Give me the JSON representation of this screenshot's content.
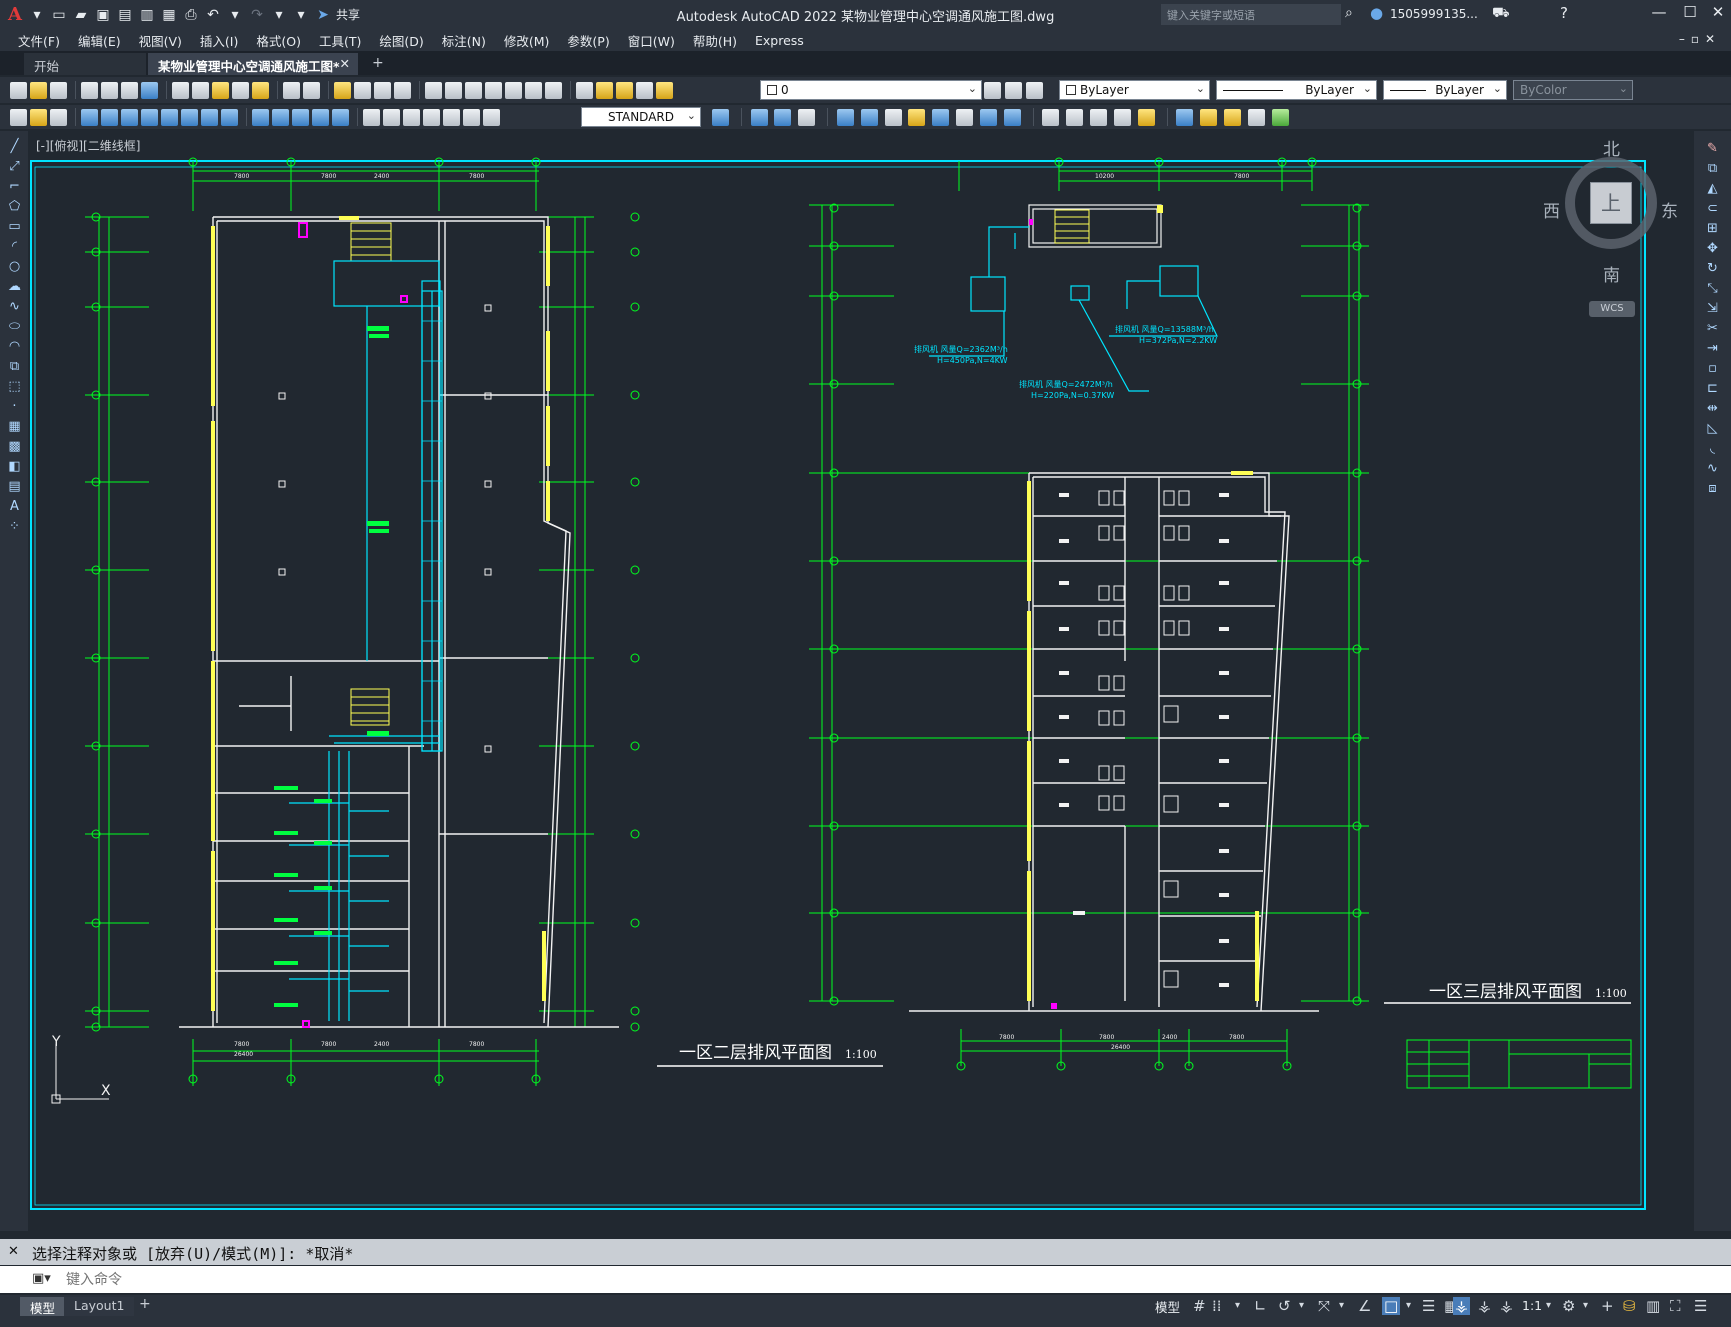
{
  "app": {
    "title": "Autodesk AutoCAD 2022    某物业管理中心空调通风施工图.dwg",
    "logo": "A",
    "share_label": "共享",
    "search_placeholder": "键入关键字或短语",
    "user": "1505999135...",
    "window_controls": [
      "—",
      "☐",
      "✕"
    ]
  },
  "menu": [
    "文件(F)",
    "编辑(E)",
    "视图(V)",
    "插入(I)",
    "格式(O)",
    "工具(T)",
    "绘图(D)",
    "标注(N)",
    "修改(M)",
    "参数(P)",
    "窗口(W)",
    "帮助(H)",
    "Express"
  ],
  "tabs": [
    {
      "label": "开始",
      "active": false
    },
    {
      "label": "某物业管理中心空调通风施工图*",
      "active": true
    }
  ],
  "toolbar": {
    "layer": "0",
    "color": "ByLayer",
    "linetype": "ByLayer",
    "lineweight": "ByLayer",
    "plotstyle": "ByColor",
    "textstyle": "STANDARD"
  },
  "viewport": {
    "label": "[-][俯视][二维线框]",
    "viewcube": {
      "north": "北",
      "south": "南",
      "east": "东",
      "west": "西",
      "top": "上",
      "ucs": "WCS"
    }
  },
  "drawing": {
    "left_plan_title": "一区二层排风平面图",
    "right_plan_title": "一区三层排风平面图",
    "scale": "1:100",
    "notes": [
      "排风机 风量Q=2362M³/h",
      "H=450Pa,N=4KW",
      "排风机 风量Q=2472M³/h",
      "H=220Pa,N=0.37KW",
      "排风机 风量Q=13588M³/h",
      "H=372Pa,N=2.2KW"
    ],
    "ucs_x": "X",
    "ucs_y": "Y"
  },
  "command": {
    "history": "选择注释对象或 [放弃(U)/模式(M)]: *取消*",
    "placeholder": "键入命令"
  },
  "status": {
    "layout_tabs": [
      "模型",
      "Layout1"
    ],
    "model_label": "模型",
    "scale": "1:1"
  },
  "colors": {
    "frame": "#00e5ff",
    "grid_axis": "#00ff20",
    "wall": "#f2f2f2",
    "column": "#ffff55",
    "duct": "#00e5ff",
    "label": "#00ff40",
    "accent": "#ff00ff"
  }
}
